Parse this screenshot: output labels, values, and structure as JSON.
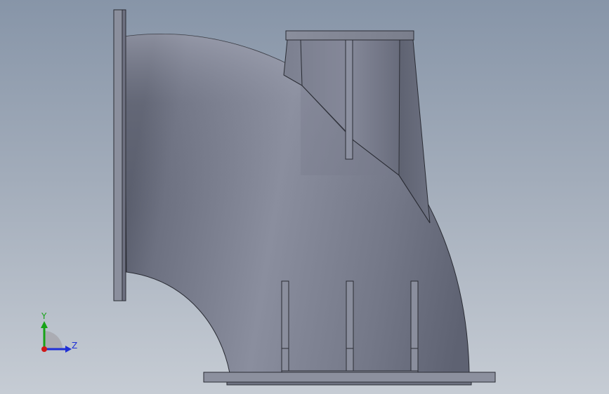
{
  "viewport": {
    "model": "pipe-elbow-with-flanged-branch",
    "background_top": "#8795a8",
    "background_bottom": "#c6ccd4",
    "part_color": "#7e8292"
  },
  "triad": {
    "y_label": "Y",
    "z_label": "Z",
    "y_color": "#17a317",
    "z_color": "#1f2fd6",
    "x_color": "#d01818"
  }
}
